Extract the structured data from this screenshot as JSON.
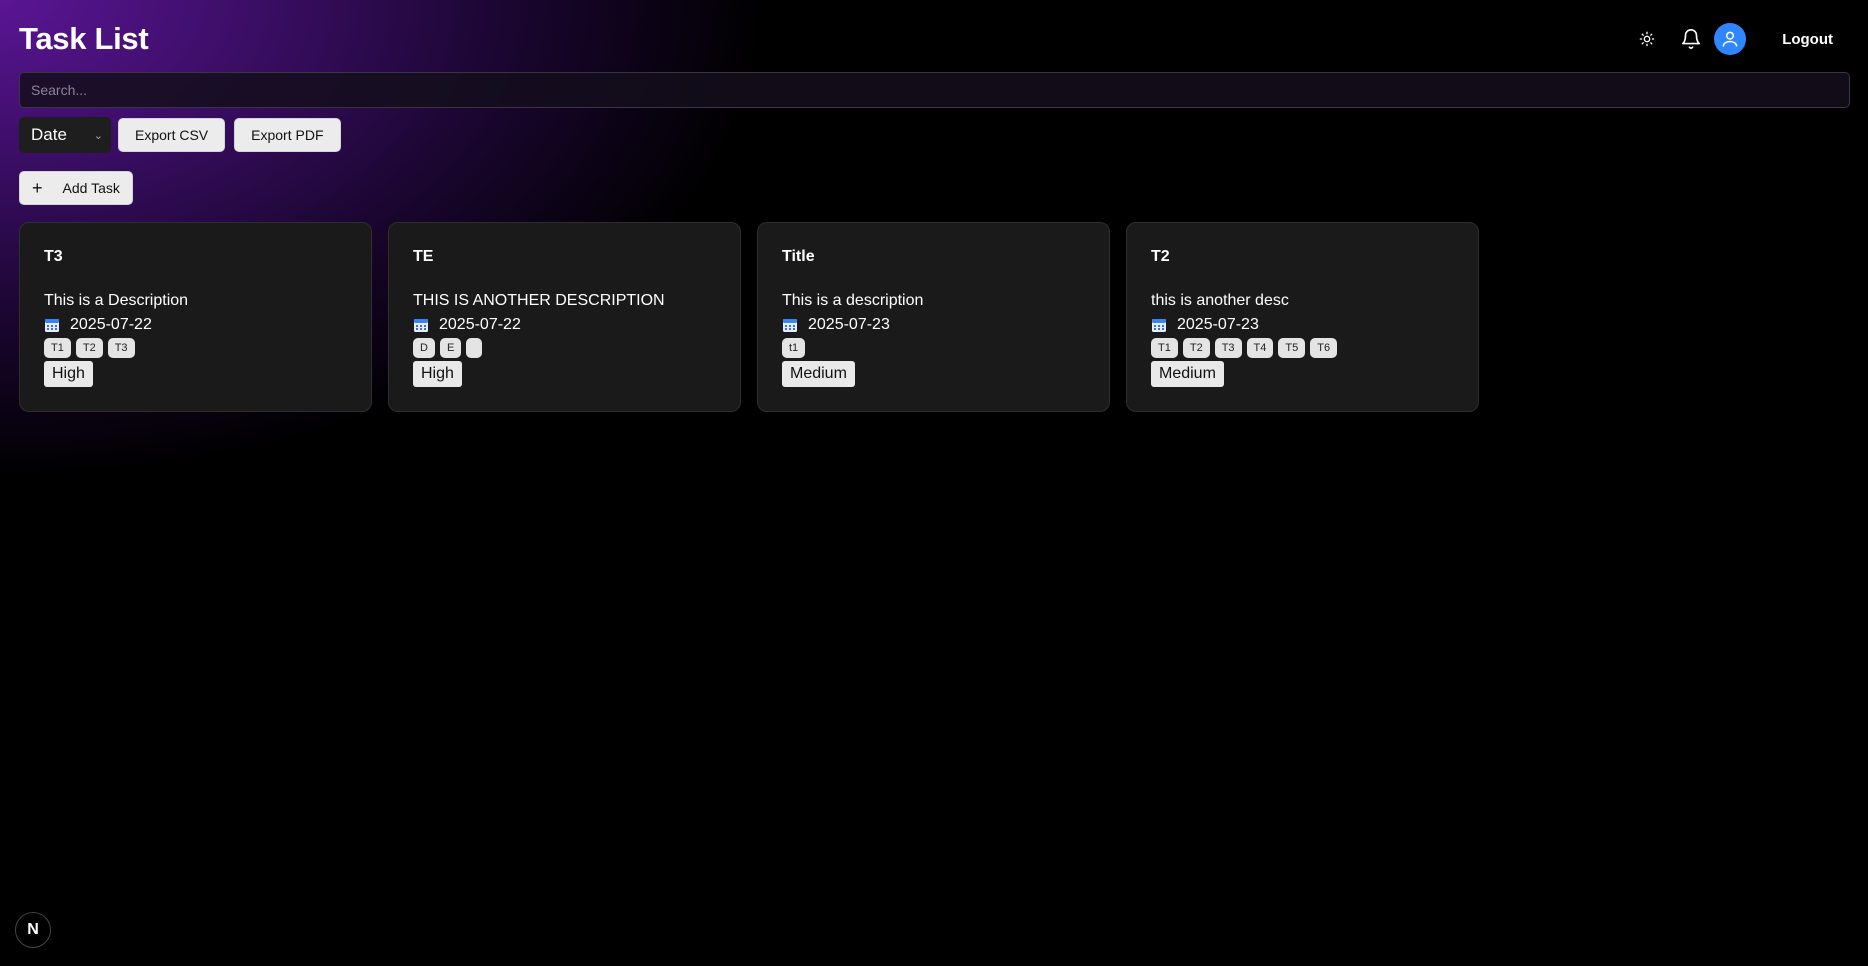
{
  "header": {
    "title": "Task List",
    "theme_icon": "sun-icon",
    "notification_icon": "bell-icon",
    "avatar_icon": "user-icon",
    "logout_label": "Logout"
  },
  "search": {
    "placeholder": "Search...",
    "value": ""
  },
  "toolbar": {
    "sort_value": "Date",
    "export_csv_label": "Export CSV",
    "export_pdf_label": "Export PDF"
  },
  "add_task_label": "Add Task",
  "tasks": [
    {
      "title": "T3",
      "description": "This is a Description",
      "date": "2025-07-22",
      "tags": [
        "T1",
        "T2",
        "T3"
      ],
      "priority": "High"
    },
    {
      "title": "TE",
      "description": "THIS IS ANOTHER DESCRIPTION",
      "date": "2025-07-22",
      "tags": [
        "D",
        "E",
        ""
      ],
      "priority": "High"
    },
    {
      "title": "Title",
      "description": "This is a description",
      "date": "2025-07-23",
      "tags": [
        "t1"
      ],
      "priority": "Medium"
    },
    {
      "title": "T2",
      "description": "this is another desc",
      "date": "2025-07-23",
      "tags": [
        "T1",
        "T2",
        "T3",
        "T4",
        "T5",
        "T6"
      ],
      "priority": "Medium"
    }
  ],
  "badge": "N",
  "colors": {
    "accent": "#2f86ff",
    "card_bg": "#1a1a1a",
    "gradient": "#5a1594"
  }
}
